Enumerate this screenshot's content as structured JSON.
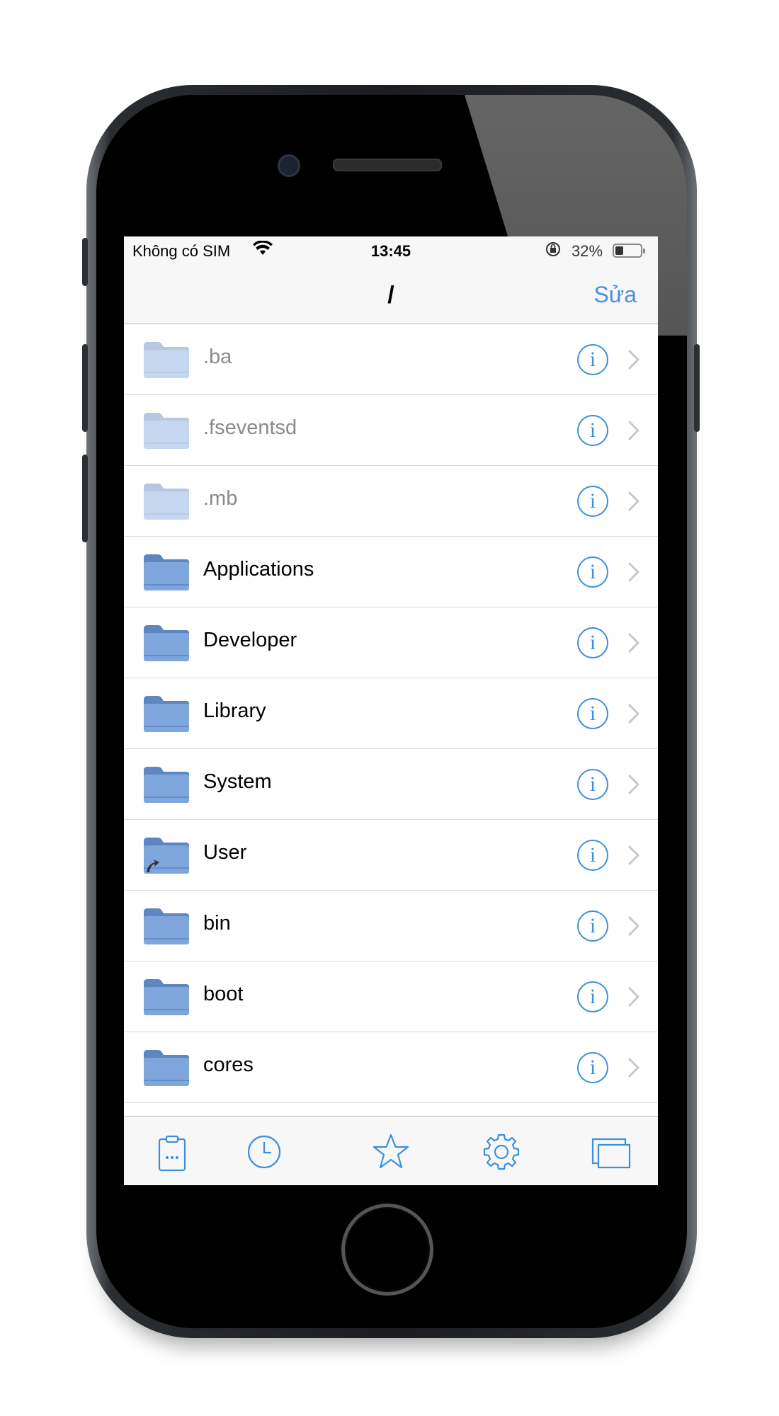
{
  "status_bar": {
    "carrier": "Không có SIM",
    "time": "13:45",
    "battery_percent": "32%",
    "battery_level": 0.32
  },
  "nav": {
    "title": "/",
    "edit_label": "Sửa"
  },
  "items": [
    {
      "name": ".ba",
      "hidden": true,
      "symlink": false
    },
    {
      "name": ".fseventsd",
      "hidden": true,
      "symlink": false
    },
    {
      "name": ".mb",
      "hidden": true,
      "symlink": false
    },
    {
      "name": "Applications",
      "hidden": false,
      "symlink": false
    },
    {
      "name": "Developer",
      "hidden": false,
      "symlink": false
    },
    {
      "name": "Library",
      "hidden": false,
      "symlink": false
    },
    {
      "name": "System",
      "hidden": false,
      "symlink": false
    },
    {
      "name": "User",
      "hidden": false,
      "symlink": true
    },
    {
      "name": "bin",
      "hidden": false,
      "symlink": false
    },
    {
      "name": "boot",
      "hidden": false,
      "symlink": false
    },
    {
      "name": "cores",
      "hidden": false,
      "symlink": false
    }
  ],
  "tabs": [
    {
      "icon": "clipboard-icon",
      "name": "tab-clipboard"
    },
    {
      "icon": "clock-icon",
      "name": "tab-recent"
    },
    {
      "icon": "star-icon",
      "name": "tab-favorites"
    },
    {
      "icon": "gear-icon",
      "name": "tab-settings"
    },
    {
      "icon": "windows-icon",
      "name": "tab-windows"
    }
  ],
  "colors": {
    "accent": "#3b8fe0",
    "folder": "#7fa6dc",
    "folder_tab": "#5d86c2"
  }
}
